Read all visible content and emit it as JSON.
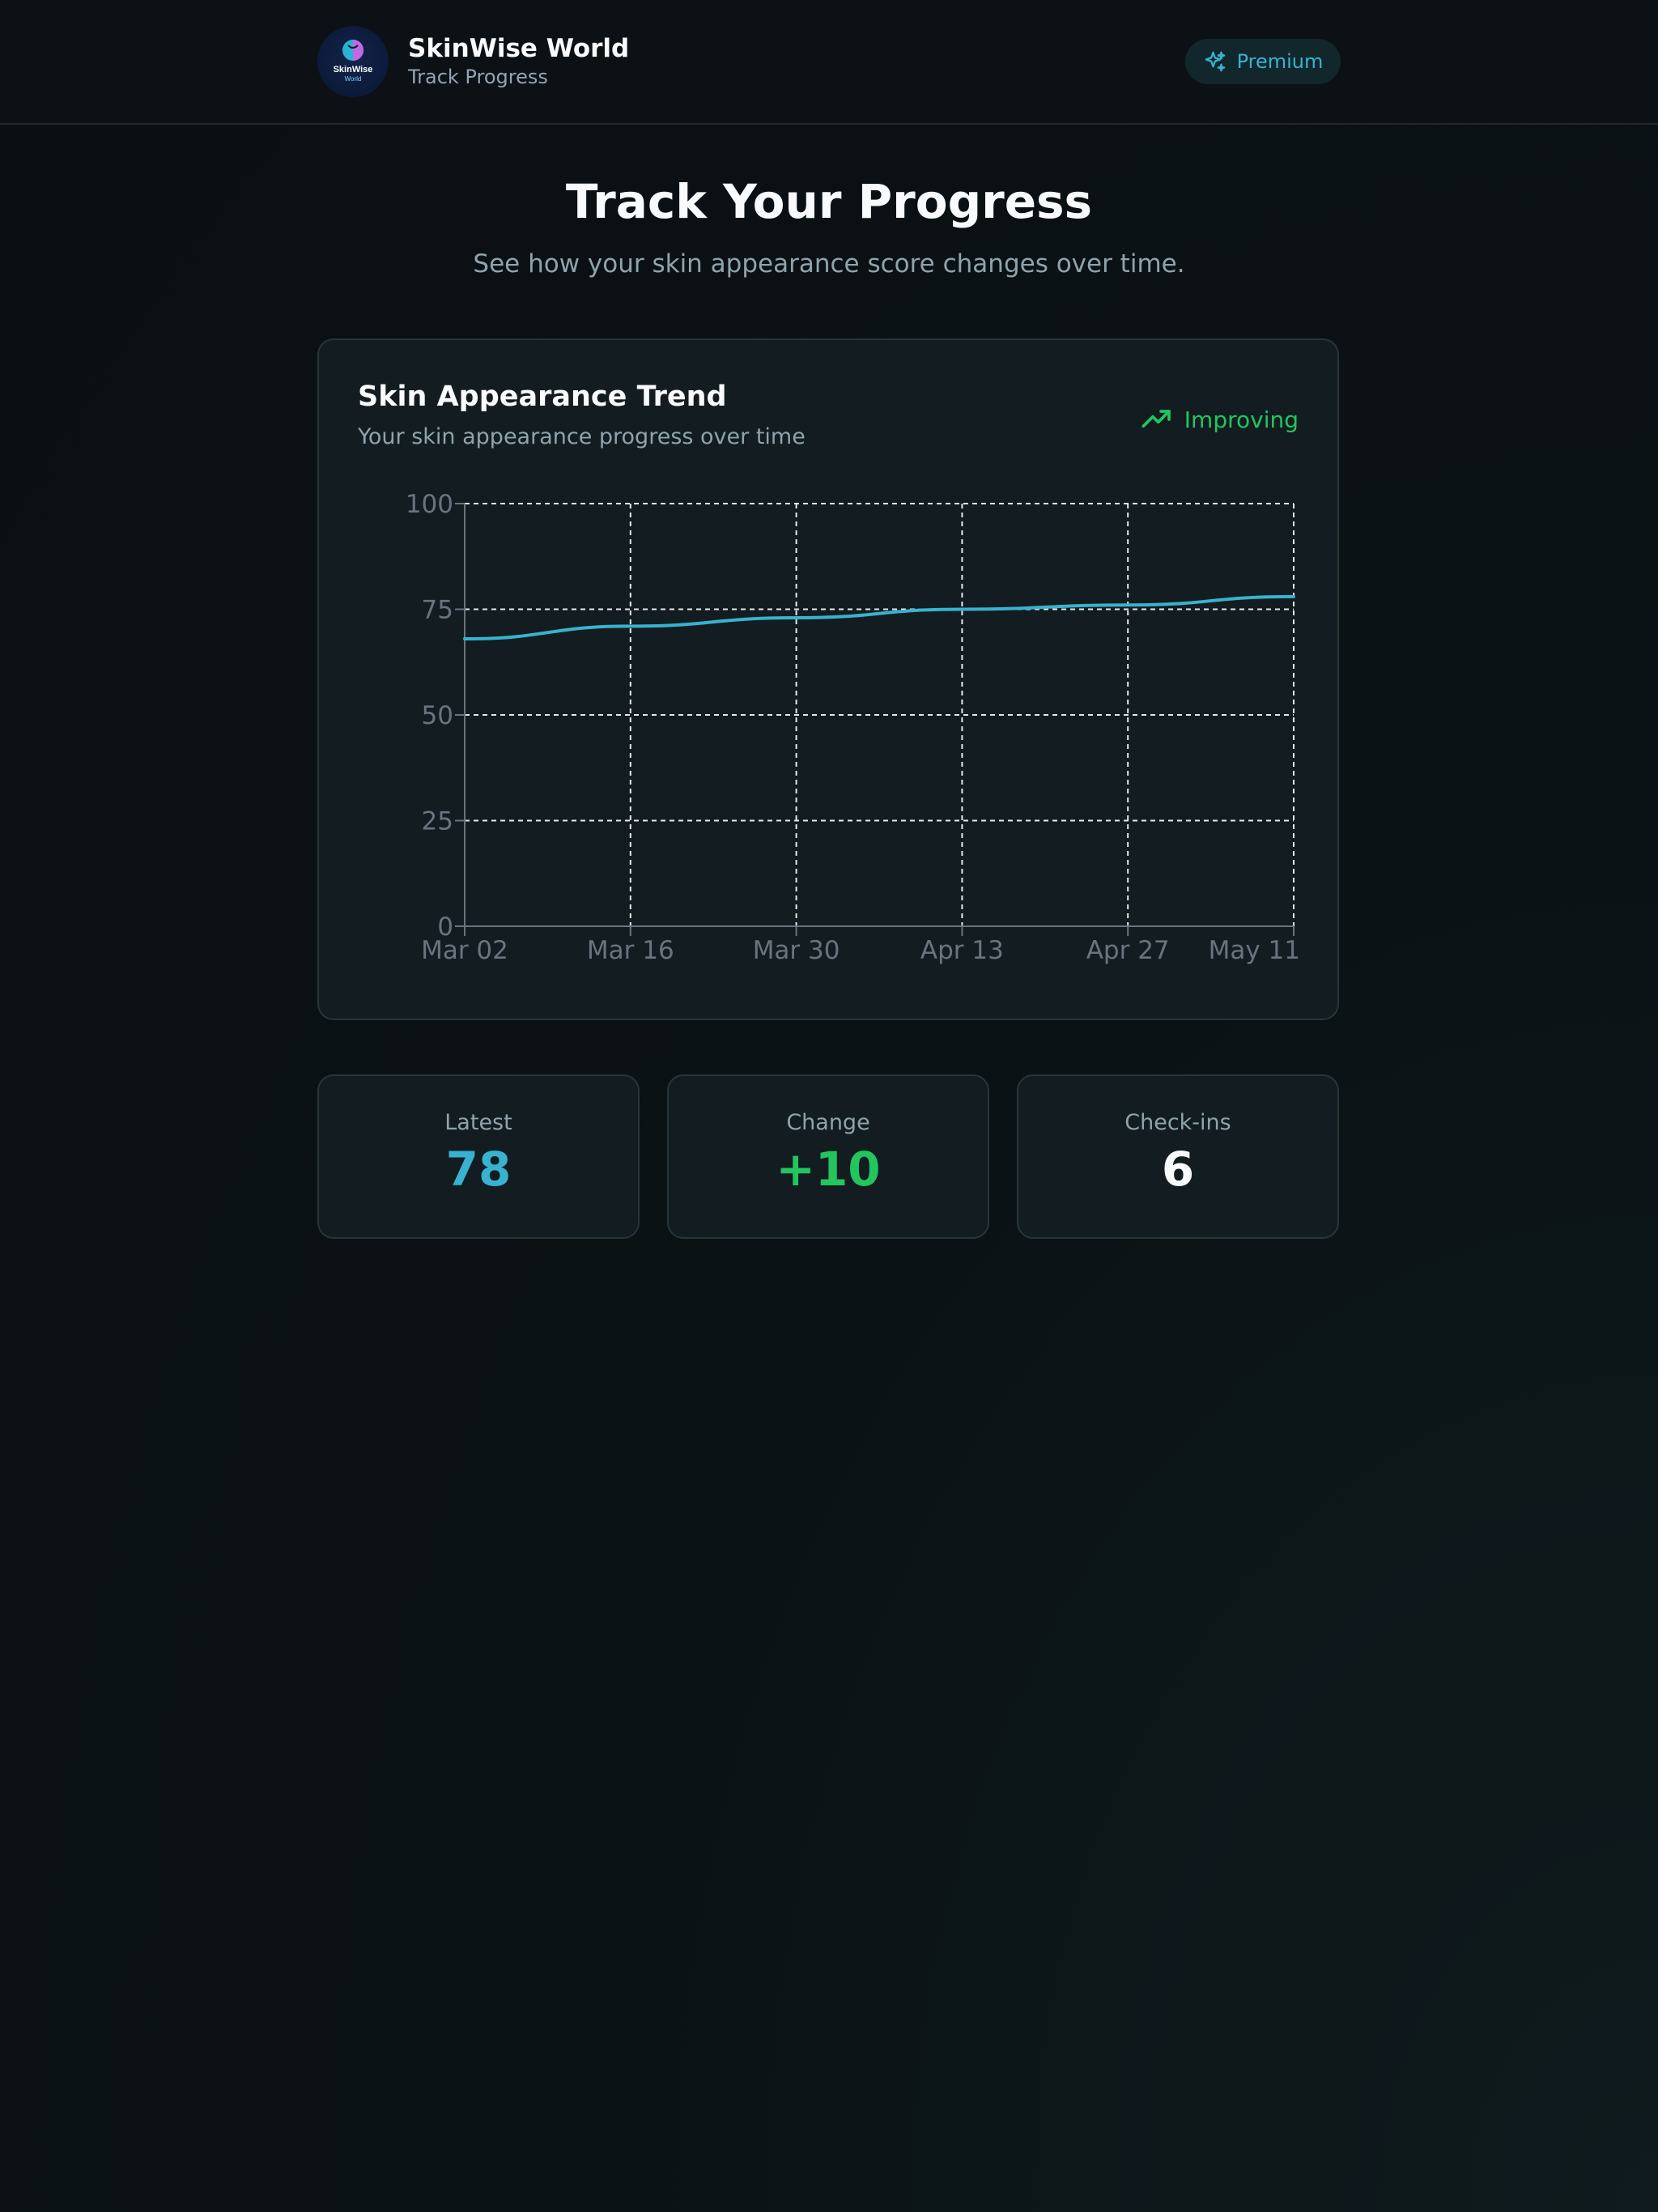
{
  "header": {
    "app_name": "SkinWise World",
    "subtitle": "Track Progress",
    "logo_text_top": "SkinWise",
    "logo_text_bottom": "World",
    "premium_label": "Premium",
    "premium_icon": "sparkles-icon"
  },
  "page": {
    "title": "Track Your Progress",
    "subtitle": "See how your skin appearance score changes over time."
  },
  "trend_card": {
    "title": "Skin Appearance Trend",
    "subtitle": "Your skin appearance progress over time",
    "status_label": "Improving",
    "status_icon": "trending-up-icon"
  },
  "chart_data": {
    "type": "line",
    "x": [
      "Mar 02",
      "Mar 16",
      "Mar 30",
      "Apr 13",
      "Apr 27",
      "May 11"
    ],
    "series": [
      {
        "values": [
          68,
          71,
          73,
          75,
          76,
          78
        ],
        "color": "#38b2d0"
      }
    ],
    "ylim": [
      0,
      100
    ],
    "yticks": [
      0,
      25,
      50,
      75,
      100
    ],
    "grid": true,
    "legend": false
  },
  "stats": [
    {
      "label": "Latest",
      "value": "78",
      "color": "#38b2d0"
    },
    {
      "label": "Change",
      "value": "+10",
      "color": "#22c55e"
    },
    {
      "label": "Check-ins",
      "value": "6",
      "color": "#f8fafc"
    }
  ],
  "colors": {
    "accent": "#38b2d0",
    "positive": "#22c55e",
    "background": "#0b1114",
    "card": "#131c20"
  }
}
